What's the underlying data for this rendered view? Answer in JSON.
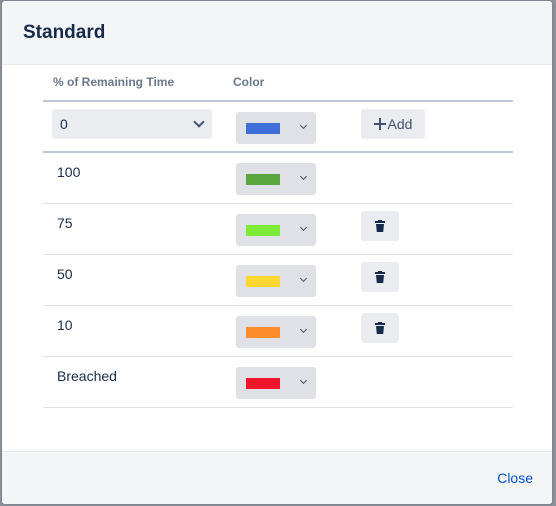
{
  "dialog": {
    "title": "Standard",
    "close_label": "Close"
  },
  "table": {
    "headers": {
      "percent": "% of Remaining Time",
      "color": "Color"
    },
    "add_row": {
      "percent_value": "0",
      "color": "#3e6fd8",
      "add_label": "Add"
    },
    "rows": [
      {
        "value": "100",
        "color": "#5aa63f",
        "deletable": false
      },
      {
        "value": "75",
        "color": "#7dea37",
        "deletable": true
      },
      {
        "value": "50",
        "color": "#fed730",
        "deletable": true
      },
      {
        "value": "10",
        "color": "#fc8d2a",
        "deletable": true
      },
      {
        "value": "Breached",
        "color": "#f0152a",
        "deletable": false
      }
    ]
  },
  "icons": {
    "add": "plus-icon",
    "delete": "trash-icon",
    "dropdown": "chevron-down-icon"
  }
}
